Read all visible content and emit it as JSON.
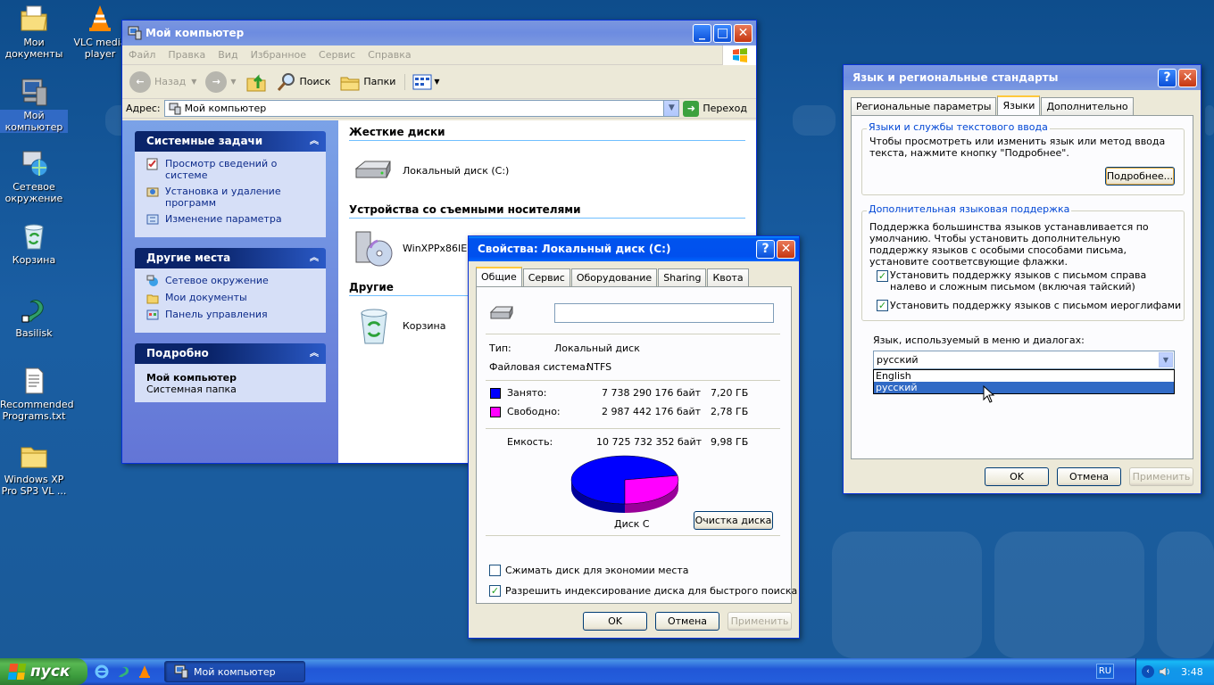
{
  "desktop": {
    "icons": [
      {
        "label": "Мои документы"
      },
      {
        "label": "VLC media player"
      },
      {
        "label": "Мой компьютер"
      },
      {
        "label": "Сетевое окружение"
      },
      {
        "label": "Корзина"
      },
      {
        "label": "Basilisk"
      },
      {
        "label": "Recommended Programs.txt"
      },
      {
        "label": "Windows XP Pro SP3 VL ..."
      }
    ]
  },
  "explorer": {
    "title": "Мой компьютер",
    "menu": [
      "Файл",
      "Правка",
      "Вид",
      "Избранное",
      "Сервис",
      "Справка"
    ],
    "toolbar": {
      "back": "Назад",
      "search": "Поиск",
      "folders": "Папки"
    },
    "address": {
      "label": "Адрес:",
      "value": "Мой компьютер",
      "go": "Переход"
    },
    "system_tasks": {
      "title": "Системные задачи",
      "links": [
        "Просмотр сведений о системе",
        "Установка и удаление программ",
        "Изменение параметра"
      ]
    },
    "other_places": {
      "title": "Другие места",
      "links": [
        "Сетевое окружение",
        "Мои документы",
        "Панель управления"
      ]
    },
    "details": {
      "title": "Подробно",
      "name": "Мой компьютер",
      "desc": "Системная папка"
    },
    "groups": {
      "hard_disks": "Жесткие диски",
      "local_disk": "Локальный диск (C:)",
      "removable": "Устройства со съемными носителями",
      "cd_drive": "WinXPPx86IE (D",
      "other": "Другие",
      "recycle": "Корзина"
    }
  },
  "props": {
    "title": "Свойства: Локальный диск (C:)",
    "tabs": [
      "Общие",
      "Сервис",
      "Оборудование",
      "Sharing",
      "Квота"
    ],
    "type_label": "Тип:",
    "type_value": "Локальный диск",
    "fs_label": "Файловая система:",
    "fs_value": "NTFS",
    "used_label": "Занято:",
    "used_bytes": "7 738 290 176 байт",
    "used_gb": "7,20 ГБ",
    "free_label": "Свободно:",
    "free_bytes": "2 987 442 176 байт",
    "free_gb": "2,78 ГБ",
    "cap_label": "Емкость:",
    "cap_bytes": "10 725 732 352 байт",
    "cap_gb": "9,98 ГБ",
    "disk_label": "Диск C",
    "cleanup": "Очистка диска",
    "compress": "Сжимать диск для экономии места",
    "index": "Разрешить индексирование диска для быстрого поиска",
    "compress_checked": false,
    "index_checked": true,
    "ok": "OK",
    "cancel": "Отмена",
    "apply": "Применить",
    "colors": {
      "used": "#0000ff",
      "free": "#ff00ff"
    },
    "usage_chart": {
      "used_fraction": 0.7215
    }
  },
  "lang": {
    "title": "Язык и региональные стандарты",
    "tabs": [
      "Региональные параметры",
      "Языки",
      "Дополнительно"
    ],
    "g1_title": "Языки и службы текстового ввода",
    "g1_text": "Чтобы просмотреть или изменить язык или метод ввода текста, нажмите кнопку \"Подробнее\".",
    "details_btn": "Подробнее...",
    "g2_title": "Дополнительная языковая поддержка",
    "g2_text": "Поддержка большинства языков устанавливается по умолчанию. Чтобы установить дополнительную поддержку языков с особыми способами письма, установите соответсвующие флажки.",
    "cb1": "Установить поддержку языков с письмом справа налево и сложным письмом (включая тайский)",
    "cb2": "Установить поддержку языков с письмом иероглифами",
    "ui_lang_label": "Язык, используемый в меню и диалогах:",
    "ui_lang_value": "русский",
    "options": [
      "English",
      "русский"
    ],
    "ok": "OK",
    "cancel": "Отмена",
    "apply": "Применить"
  },
  "taskbar": {
    "start": "пуск",
    "task": "Мой компьютер",
    "lang": "RU",
    "clock": "3:48"
  }
}
